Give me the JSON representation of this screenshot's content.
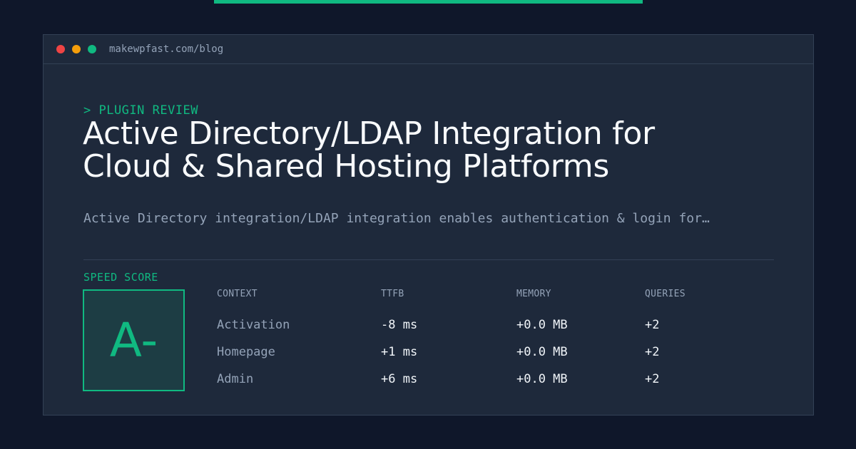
{
  "colors": {
    "accent": "#10b981",
    "dot_red": "#ef4444",
    "dot_yellow": "#f59e0b",
    "dot_green": "#10b981"
  },
  "window": {
    "url": "makewpfast.com/blog"
  },
  "post": {
    "kicker": "> PLUGIN REVIEW",
    "title_line1": "Active Directory/LDAP Integration for",
    "title_line2": "Cloud & Shared Hosting Platforms",
    "description": "Active Directory integration/LDAP integration enables authentication & login for…"
  },
  "speed": {
    "label": "SPEED SCORE",
    "grade": "A-",
    "headers": [
      "CONTEXT",
      "TTFB",
      "MEMORY",
      "QUERIES"
    ],
    "rows": [
      {
        "context": "Activation",
        "ttfb": "-8 ms",
        "memory": "+0.0 MB",
        "queries": "+2"
      },
      {
        "context": "Homepage",
        "ttfb": "+1 ms",
        "memory": "+0.0 MB",
        "queries": "+2"
      },
      {
        "context": "Admin",
        "ttfb": "+6 ms",
        "memory": "+0.0 MB",
        "queries": "+2"
      }
    ]
  }
}
